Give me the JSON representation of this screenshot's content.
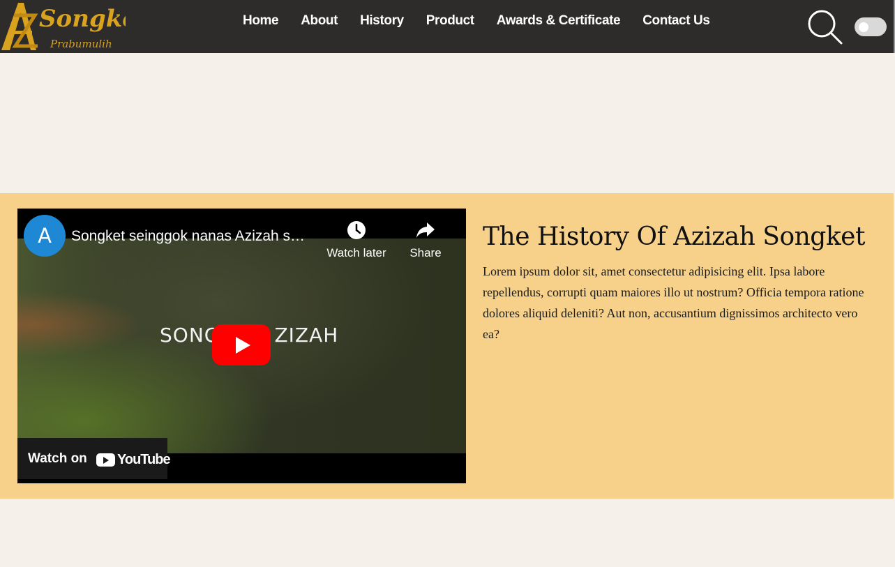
{
  "nav": {
    "logo_text": "Songket",
    "logo_subtext": "Prabumulih",
    "logo_letters": "A Z",
    "links": [
      {
        "label": "Home"
      },
      {
        "label": "About"
      },
      {
        "label": "History"
      },
      {
        "label": "Product"
      },
      {
        "label": "Awards & Certificate"
      },
      {
        "label": "Contact Us"
      }
    ],
    "search_icon": "search-icon",
    "theme_toggle": {
      "state": "off"
    }
  },
  "video": {
    "channel_initial": "A",
    "title": "Songket seinggok nanas Azizah s…",
    "actions": [
      {
        "label": "Watch later",
        "icon": "clock-icon"
      },
      {
        "label": "Share",
        "icon": "share-arrow-icon"
      }
    ],
    "overlay_text_left": "SONG",
    "overlay_text_right": "ZIZAH",
    "watch_on_label": "Watch on",
    "youtube_wordmark": "YouTube"
  },
  "history": {
    "title": "The History Of Azizah Songket",
    "body": "Lorem ipsum dolor sit, amet consectetur adipisicing elit. Ipsa labore repellendus, corrupti quam maiores illo ut nostrum? Officia tempora ratione dolores aliquid deleniti? Aut non, accusantium dignissimos architecto vero ea?"
  },
  "colors": {
    "navbar_bg": "#2e2c2a",
    "page_bg": "#f5f0ea",
    "section_bg": "#f7d189",
    "logo_gold": "#d9a21f",
    "youtube_red": "#ff0000"
  }
}
